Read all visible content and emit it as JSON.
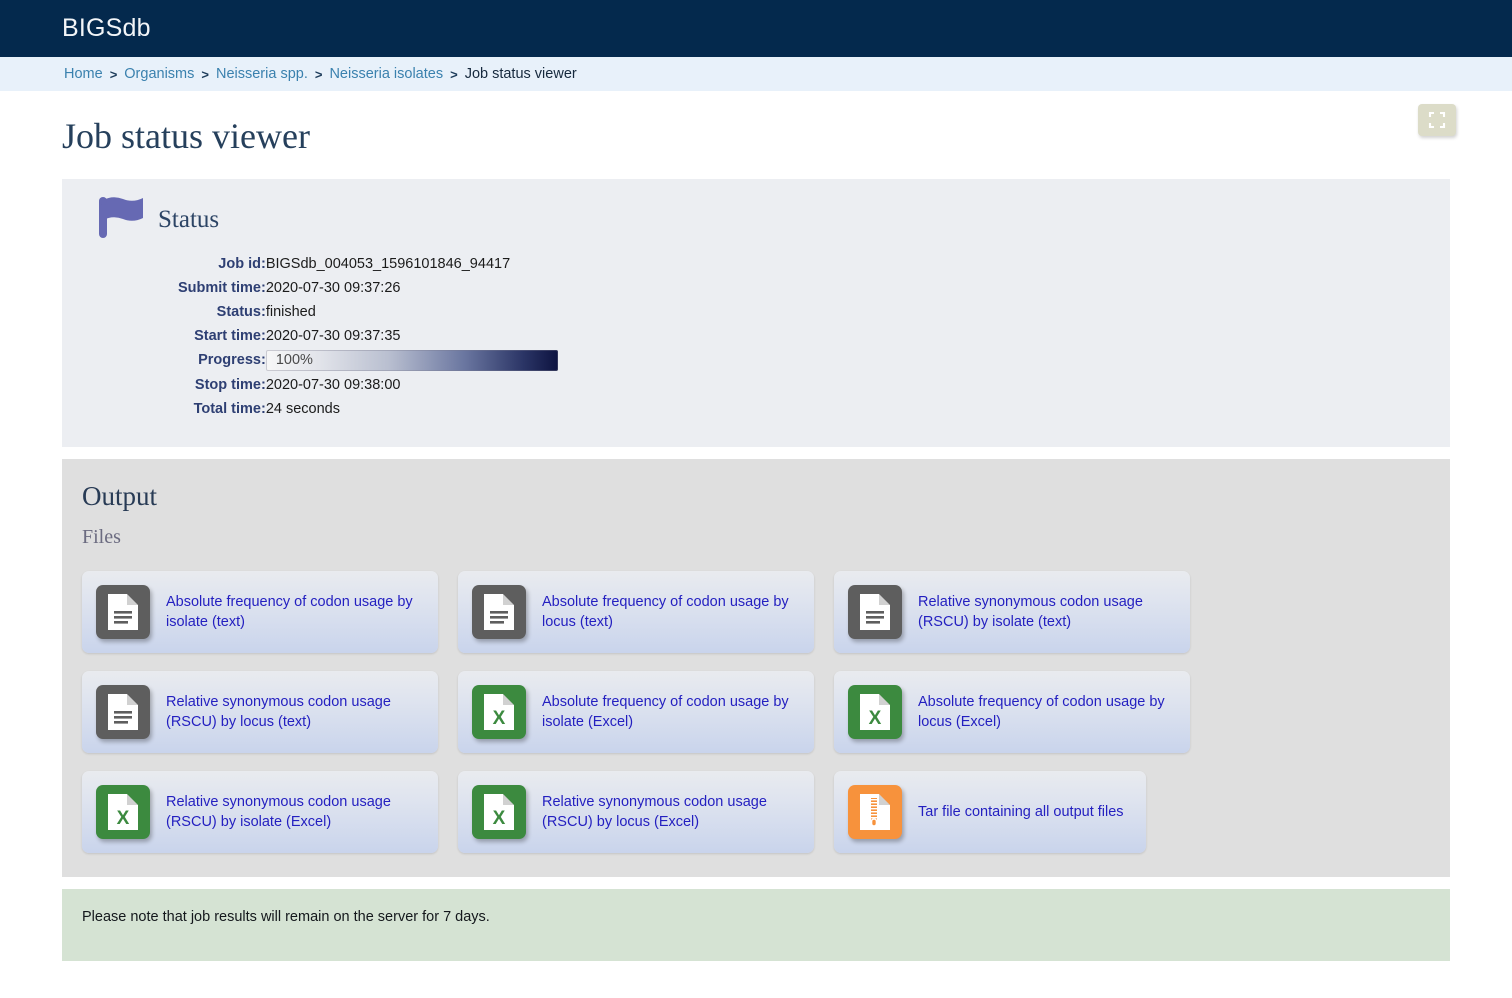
{
  "header": {
    "title": "BIGSdb"
  },
  "breadcrumb": {
    "items": [
      {
        "label": "Home",
        "current": false
      },
      {
        "label": "Organisms",
        "current": false
      },
      {
        "label": "Neisseria spp.",
        "current": false
      },
      {
        "label": "Neisseria isolates",
        "current": false
      },
      {
        "label": "Job status viewer",
        "current": true
      }
    ],
    "separator": ">"
  },
  "page": {
    "title": "Job status viewer",
    "expand_icon": "fullscreen-expand-icon"
  },
  "status": {
    "heading": "Status",
    "flag_icon": "flag-icon",
    "rows": [
      {
        "label": "Job id:",
        "value": "BIGSdb_004053_1596101846_94417"
      },
      {
        "label": "Submit time:",
        "value": "2020-07-30 09:37:26"
      },
      {
        "label": "Status:",
        "value": "finished"
      },
      {
        "label": "Start time:",
        "value": "2020-07-30 09:37:35"
      },
      {
        "label": "Progress:",
        "value": "100%",
        "type": "progress",
        "percent": 100
      },
      {
        "label": "Stop time:",
        "value": "2020-07-30 09:38:00"
      },
      {
        "label": "Total time:",
        "value": "24 seconds"
      }
    ]
  },
  "output": {
    "heading": "Output",
    "subheading": "Files",
    "files": [
      {
        "label": "Absolute frequency of codon usage by isolate (text)",
        "icon": "text-file-icon",
        "type": "text"
      },
      {
        "label": "Absolute frequency of codon usage by locus (text)",
        "icon": "text-file-icon",
        "type": "text"
      },
      {
        "label": "Relative synonymous codon usage (RSCU) by isolate (text)",
        "icon": "text-file-icon",
        "type": "text"
      },
      {
        "label": "Relative synonymous codon usage (RSCU) by locus (text)",
        "icon": "text-file-icon",
        "type": "text"
      },
      {
        "label": "Absolute frequency of codon usage by isolate (Excel)",
        "icon": "excel-file-icon",
        "type": "excel"
      },
      {
        "label": "Absolute frequency of codon usage by locus (Excel)",
        "icon": "excel-file-icon",
        "type": "excel"
      },
      {
        "label": "Relative synonymous codon usage (RSCU) by isolate (Excel)",
        "icon": "excel-file-icon",
        "type": "excel"
      },
      {
        "label": "Relative synonymous codon usage (RSCU) by locus (Excel)",
        "icon": "excel-file-icon",
        "type": "excel"
      },
      {
        "label": "Tar file containing all output files",
        "icon": "archive-file-icon",
        "type": "archive"
      }
    ]
  },
  "note": {
    "text": "Please note that job results will remain on the server for 7 days."
  },
  "colors": {
    "header_bg": "#04294d",
    "breadcrumb_bg": "#e8f1fa",
    "link": "#3a81ae",
    "file_link": "#231fc0",
    "status_panel_bg": "#eceef2",
    "output_panel_bg": "#dfdfdf",
    "note_bg": "#d5e3d3",
    "flag": "#6669b3",
    "text_icon": "#5e5e5e",
    "excel_icon": "#3c8a3f",
    "archive_icon": "#f7923c"
  }
}
